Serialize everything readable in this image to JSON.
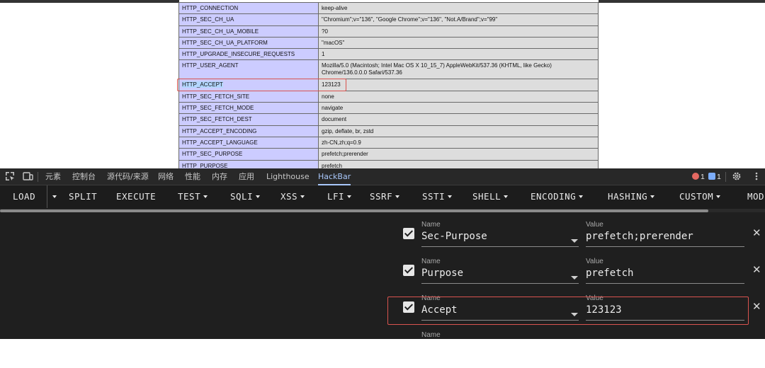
{
  "env_table": {
    "rows": [
      {
        "key": "HTTP_CONNECTION",
        "value": "keep-alive"
      },
      {
        "key": "HTTP_SEC_CH_UA",
        "value": "\"Chromium\";v=\"136\", \"Google Chrome\";v=\"136\", \"Not.A/Brand\";v=\"99\""
      },
      {
        "key": "HTTP_SEC_CH_UA_MOBILE",
        "value": "?0"
      },
      {
        "key": "HTTP_SEC_CH_UA_PLATFORM",
        "value": "\"macOS\""
      },
      {
        "key": "HTTP_UPGRADE_INSECURE_REQUESTS",
        "value": "1"
      },
      {
        "key": "HTTP_USER_AGENT",
        "value": "Mozilla/5.0 (Macintosh; Intel Mac OS X 10_15_7) AppleWebKit/537.36 (KHTML, like Gecko) Chrome/136.0.0.0 Safari/537.36"
      },
      {
        "key": "HTTP_ACCEPT",
        "value": "123123"
      },
      {
        "key": "HTTP_SEC_FETCH_SITE",
        "value": "none"
      },
      {
        "key": "HTTP_SEC_FETCH_MODE",
        "value": "navigate"
      },
      {
        "key": "HTTP_SEC_FETCH_DEST",
        "value": "document"
      },
      {
        "key": "HTTP_ACCEPT_ENCODING",
        "value": "gzip, deflate, br, zstd"
      },
      {
        "key": "HTTP_ACCEPT_LANGUAGE",
        "value": "zh-CN,zh;q=0.9"
      },
      {
        "key": "HTTP_SEC_PURPOSE",
        "value": "prefetch;prerender"
      },
      {
        "key": "HTTP_PURPOSE",
        "value": "prefetch"
      }
    ]
  },
  "devtools": {
    "tabs": [
      "元素",
      "控制台",
      "源代码/来源",
      "网络",
      "性能",
      "内存",
      "应用",
      "Lighthouse",
      "HackBar"
    ],
    "active_tab": "HackBar",
    "error_count": "1",
    "message_count": "1",
    "icons": [
      "inspect-icon",
      "device-toolbar-icon",
      "settings-icon",
      "more-options-icon"
    ]
  },
  "hackbar": {
    "menu": [
      {
        "label": "LOAD",
        "caret": false
      },
      {
        "label": "",
        "caret": true
      },
      {
        "label": "SPLIT",
        "caret": false
      },
      {
        "label": "EXECUTE",
        "caret": false
      },
      {
        "label": "TEST",
        "caret": true
      },
      {
        "label": "SQLI",
        "caret": true
      },
      {
        "label": "XSS",
        "caret": true
      },
      {
        "label": "LFI",
        "caret": true
      },
      {
        "label": "SSRF",
        "caret": true
      },
      {
        "label": "SSTI",
        "caret": true
      },
      {
        "label": "SHELL",
        "caret": true
      },
      {
        "label": "ENCODING",
        "caret": true
      },
      {
        "label": "HASHING",
        "caret": true
      },
      {
        "label": "CUSTOM",
        "caret": true
      },
      {
        "label": "MOD",
        "caret": false
      }
    ],
    "name_label": "Name",
    "value_label": "Value",
    "headers": [
      {
        "checked": true,
        "name": "Sec-Purpose",
        "value": "prefetch;prerender"
      },
      {
        "checked": true,
        "name": "Purpose",
        "value": "prefetch"
      },
      {
        "checked": true,
        "name": "Accept",
        "value": "123123"
      },
      {
        "checked": false,
        "name": "",
        "value": ""
      }
    ]
  }
}
